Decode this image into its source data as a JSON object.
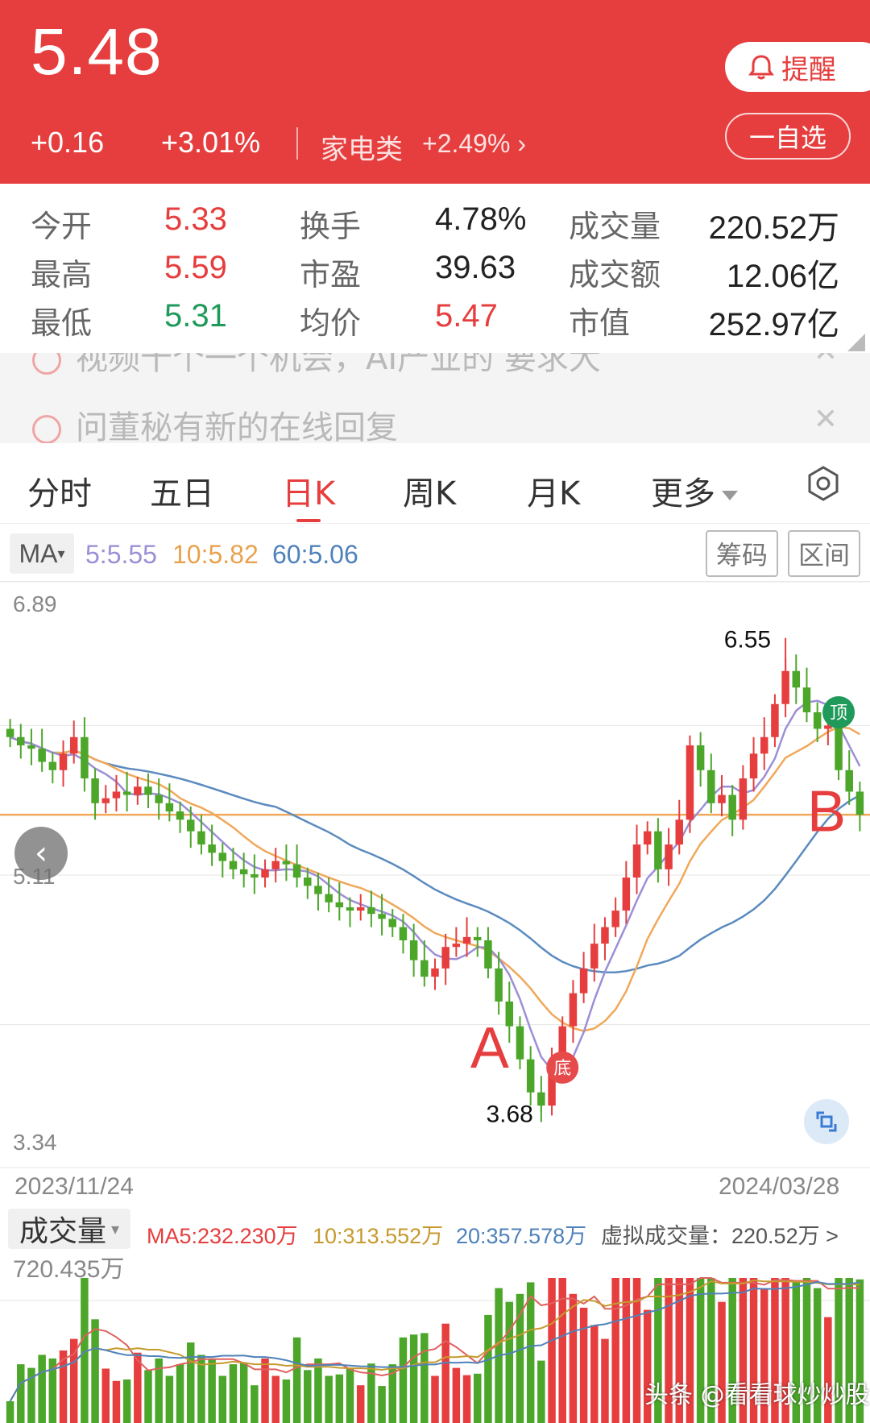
{
  "header": {
    "price": "5.48",
    "change_abs": "+0.16",
    "change_pct": "+3.01%",
    "sector_name": "家电类",
    "sector_change": "+2.49%",
    "alert_label": "提醒",
    "watchlist_label": "一自选"
  },
  "stats": {
    "open_label": "今开",
    "open": "5.33",
    "high_label": "最高",
    "high": "5.59",
    "low_label": "最低",
    "low": "5.31",
    "turnover_label": "换手",
    "turnover": "4.78%",
    "pe_label": "市盈",
    "pe": "39.63",
    "avg_label": "均价",
    "avg": "5.47",
    "volume_label": "成交量",
    "volume": "220.52万",
    "amount_label": "成交额",
    "amount": "12.06亿",
    "mktcap_label": "市值",
    "mktcap": "252.97亿"
  },
  "notices": [
    {
      "text": "视频十个一个机会，AI产业的 要求大"
    },
    {
      "text": "问董秘有新的在线回复"
    }
  ],
  "tabs": [
    {
      "label": "分时"
    },
    {
      "label": "五日"
    },
    {
      "label": "日K"
    },
    {
      "label": "周K"
    },
    {
      "label": "月K"
    },
    {
      "label": "更多"
    }
  ],
  "ma_bar": {
    "ma_label": "MA",
    "ma5": "5:5.55",
    "ma10": "10:5.82",
    "ma60": "60:5.06",
    "chips_label": "筹码",
    "range_label": "区间"
  },
  "colors": {
    "up": "#e63e3e",
    "down": "#4ca62a",
    "ma5": "#9c8fd6",
    "ma10": "#f0a85a",
    "ma60": "#5b8bbf"
  },
  "chart_labels": {
    "y_top": "6.89",
    "y_mid": "5.11",
    "y_bottom": "3.34",
    "x_start": "2023/11/24",
    "x_end": "2024/03/28",
    "peak": "6.55",
    "trough": "3.68",
    "mark_a": "A",
    "mark_b": "B",
    "bottom_badge": "底",
    "top_badge": "顶"
  },
  "volume": {
    "label": "成交量",
    "ma5": "MA5:232.230万",
    "ma10": "10:313.552万",
    "ma20": "20:357.578万",
    "virtual": "虚拟成交量：220.52万 >",
    "max": "720.435万"
  },
  "watermark": "头条 @看看球炒炒股",
  "chart_data": {
    "type": "candlestick",
    "x_start": "2023/11/24",
    "x_end": "2024/03/28",
    "ylim": [
      3.34,
      6.89
    ],
    "reference_line": 5.48,
    "annotations": [
      {
        "label": "6.55",
        "value": 6.55
      },
      {
        "label": "3.68",
        "value": 3.68
      }
    ],
    "closes": [
      5.95,
      5.9,
      5.88,
      5.8,
      5.75,
      5.85,
      5.95,
      5.7,
      5.55,
      5.58,
      5.62,
      5.6,
      5.65,
      5.6,
      5.55,
      5.5,
      5.45,
      5.38,
      5.3,
      5.25,
      5.2,
      5.15,
      5.12,
      5.1,
      5.15,
      5.2,
      5.18,
      5.1,
      5.05,
      5.0,
      4.95,
      4.92,
      4.9,
      4.92,
      4.88,
      4.85,
      4.8,
      4.72,
      4.6,
      4.5,
      4.55,
      4.68,
      4.7,
      4.74,
      4.72,
      4.55,
      4.35,
      4.2,
      4.0,
      3.8,
      3.72,
      3.95,
      4.2,
      4.4,
      4.55,
      4.7,
      4.8,
      4.9,
      5.1,
      5.3,
      5.38,
      5.15,
      5.3,
      5.45,
      5.9,
      5.75,
      5.55,
      5.6,
      5.45,
      5.7,
      5.85,
      5.95,
      6.15,
      6.35,
      6.25,
      6.1,
      6.0,
      6.02,
      5.75,
      5.62,
      5.48
    ]
  }
}
